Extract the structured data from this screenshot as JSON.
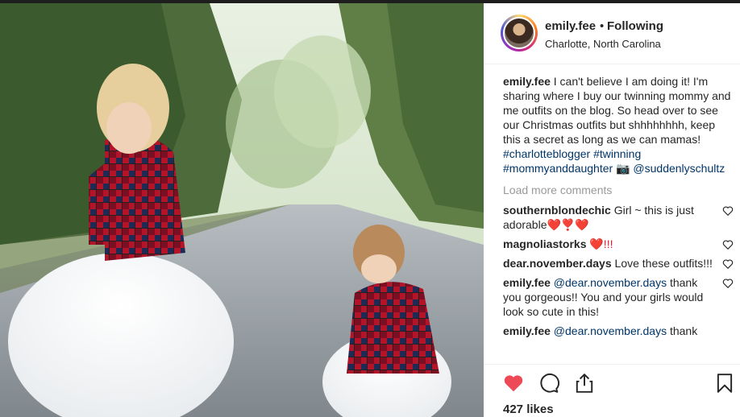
{
  "post": {
    "username": "emily.fee",
    "separator": "•",
    "follow_status": "Following",
    "location": "Charlotte, North Carolina",
    "caption_user": "emily.fee",
    "caption_text": "I can't believe I am doing it! I'm sharing where I buy our twinning mommy and me outfits on the blog. So head over to see our Christmas outfits but shhhhhhhh, keep this a secret as long as we can mamas!",
    "hashtags": [
      "#charlotteblogger",
      "#twinning",
      "#mommyanddaughter"
    ],
    "caption_emoji": "📷",
    "mention": "@suddenlyschultz",
    "load_more": "Load more comments",
    "likes": "427 likes"
  },
  "comments": [
    {
      "user": "southernblondechic",
      "text": "Girl ~ this is just adorable",
      "suffix": "❤️❣️❤️"
    },
    {
      "user": "magnoliastorks",
      "text": "",
      "suffix": "❤️!!!"
    },
    {
      "user": "dear.november.days",
      "text": "Love these outfits!!!",
      "suffix": ""
    },
    {
      "user": "emily.fee",
      "mention": "@dear.november.days",
      "text": "thank you gorgeous!! You and your girls would look so cute in this!",
      "suffix": ""
    },
    {
      "user": "emily.fee",
      "mention": "@dear.november.days",
      "text": "thank",
      "suffix": ""
    }
  ],
  "icons": {
    "like": "heart-filled-icon",
    "comment": "comment-bubble-icon",
    "share": "share-icon",
    "save": "bookmark-icon",
    "comment_like": "heart-outline-icon"
  },
  "colors": {
    "like_red": "#ed4956",
    "link_blue": "#003569",
    "muted": "#999999",
    "text": "#262626"
  }
}
